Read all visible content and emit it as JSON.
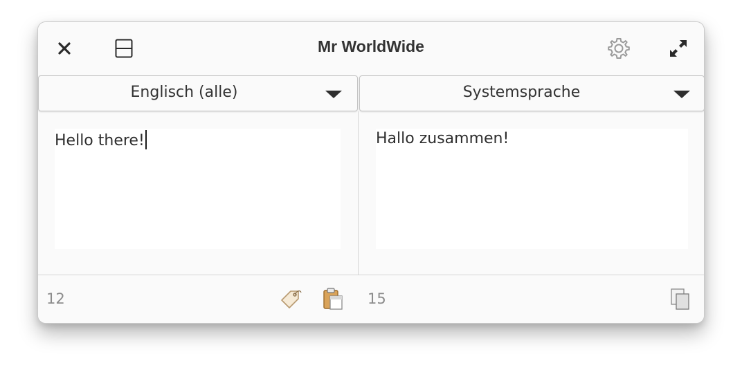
{
  "window": {
    "title": "Mr WorldWide",
    "buttons": {
      "close_icon": "close-icon",
      "layout_icon": "split-layout-icon",
      "settings_icon": "gear-icon",
      "fullscreen_icon": "expand-icon"
    }
  },
  "source": {
    "language": "Englisch (alle)",
    "text": "Hello there!",
    "char_count": "12",
    "icons": [
      "tag-icon",
      "paste-icon"
    ]
  },
  "target": {
    "language": "Systemsprache",
    "text": "Hallo zusammen!",
    "char_count": "15",
    "icons": [
      "copy-icon"
    ]
  },
  "colors": {
    "window_bg": "#fafafa",
    "text": "#333333",
    "muted": "#8c8c8c",
    "border": "#c4c4c4"
  }
}
